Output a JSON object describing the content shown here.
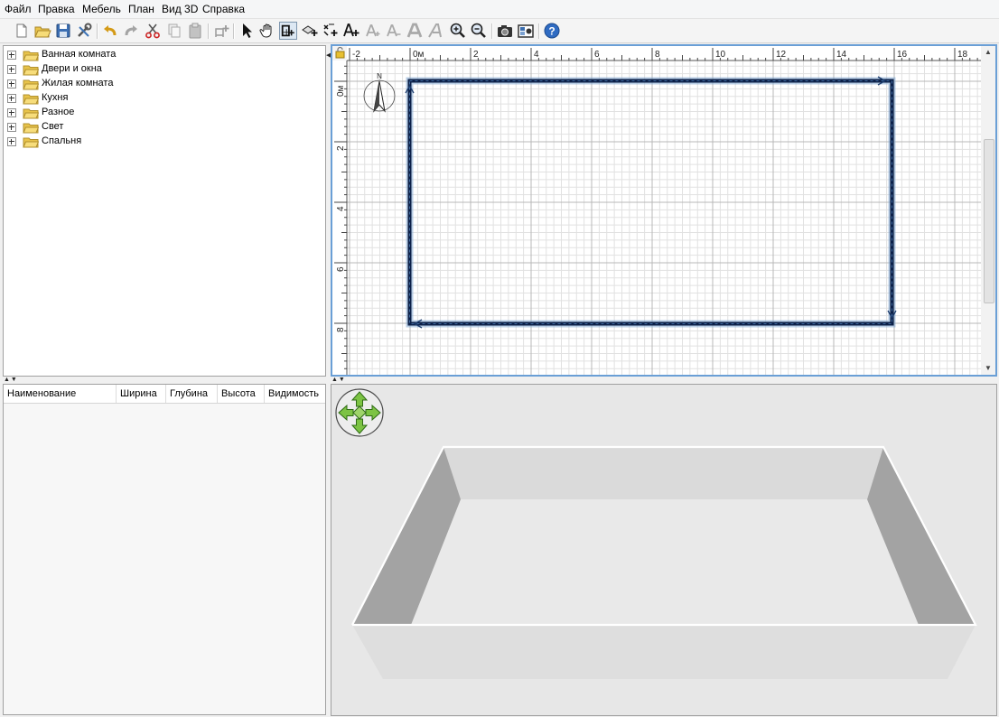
{
  "menu": [
    "Файл",
    "Правка",
    "Мебель",
    "План",
    "Вид 3D",
    "Справка"
  ],
  "toolbar_icons": [
    "new-home-icon",
    "open-icon",
    "save-icon",
    "preferences-icon",
    "undo-icon",
    "redo-icon",
    "cut-icon",
    "copy-icon",
    "paste-icon",
    "add-furniture-icon",
    "select-arrow-icon",
    "pan-hand-icon",
    "create-walls-icon",
    "create-rooms-icon",
    "create-dimensions-icon",
    "add-text-icon",
    "increase-text-icon",
    "decrease-text-icon",
    "bold-text-icon",
    "italic-text-icon",
    "zoom-in-icon",
    "zoom-out-icon",
    "create-photo-icon",
    "create-video-icon",
    "help-icon"
  ],
  "catalog": {
    "categories": [
      "Ванная комната",
      "Двери и окна",
      "Жилая комната",
      "Кухня",
      "Разное",
      "Свет",
      "Спальня"
    ]
  },
  "furniture_table": {
    "columns": [
      "Наименование",
      "Ширина",
      "Глубина",
      "Высота",
      "Видимость"
    ]
  },
  "plan": {
    "x_ticks": [
      "-2",
      "0м",
      "2",
      "4",
      "6",
      "8",
      "10",
      "12",
      "14",
      "16",
      "18"
    ],
    "y_ticks": [
      "0м",
      "2",
      "4",
      "6",
      "8"
    ],
    "compass_label": "N",
    "colors": {
      "wall": "#0c2048",
      "selection": "#6a9fd6",
      "grid": "#cfcfcf"
    }
  }
}
